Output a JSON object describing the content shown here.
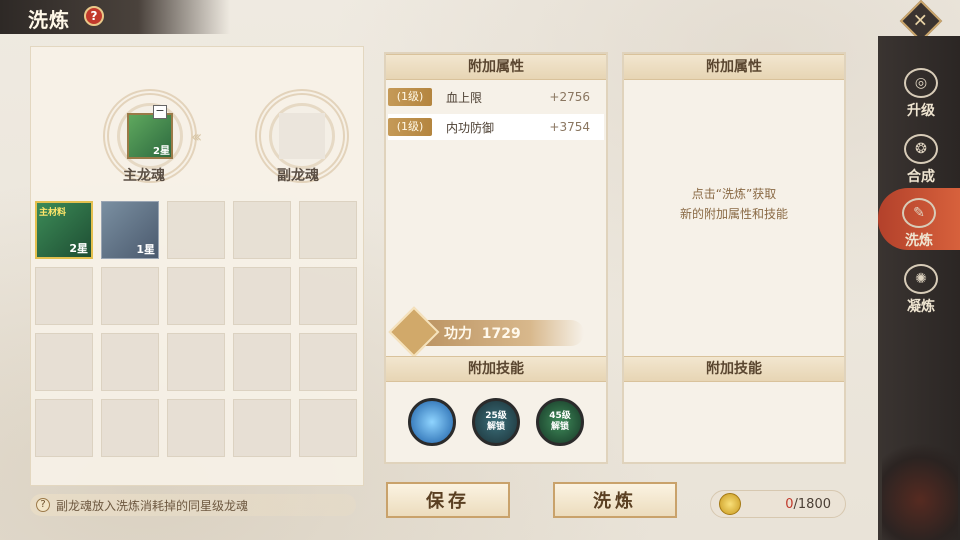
{
  "header": {
    "title": "洗炼",
    "help_label": "?"
  },
  "sidebar": {
    "items": [
      {
        "label": "升级",
        "icon": "upgrade-icon"
      },
      {
        "label": "合成",
        "icon": "synthesis-icon"
      },
      {
        "label": "洗炼",
        "icon": "refine-icon",
        "active": true
      },
      {
        "label": "凝炼",
        "icon": "condense-icon"
      }
    ]
  },
  "left": {
    "main_label": "主龙魂",
    "sub_label": "副龙魂",
    "main_item_star": "2星",
    "inventory": [
      {
        "tag": "主材料",
        "star": "2星",
        "selected": true
      },
      {
        "tag": "",
        "star": "1星",
        "selected": false
      }
    ],
    "tip": "副龙魂放入洗炼消耗掉的同星级龙魂"
  },
  "middle": {
    "attr_header": "附加属性",
    "attrs": [
      {
        "level": "(1级)",
        "name": "血上限",
        "value": "+2756"
      },
      {
        "level": "(1级)",
        "name": "内功防御",
        "value": "+3754"
      }
    ],
    "power_label": "功力",
    "power_value": "1729",
    "skill_header": "附加技能",
    "skills": [
      {
        "label": ""
      },
      {
        "label": "25级\n解锁"
      },
      {
        "label": "45级\n解锁"
      }
    ]
  },
  "right": {
    "attr_header": "附加属性",
    "placeholder_line1": "点击“洗炼”获取",
    "placeholder_line2": "新的附加属性和技能",
    "skill_header": "附加技能"
  },
  "buttons": {
    "save": "保存",
    "refine": "洗炼"
  },
  "currency": {
    "current": "0",
    "total": "/1800"
  }
}
